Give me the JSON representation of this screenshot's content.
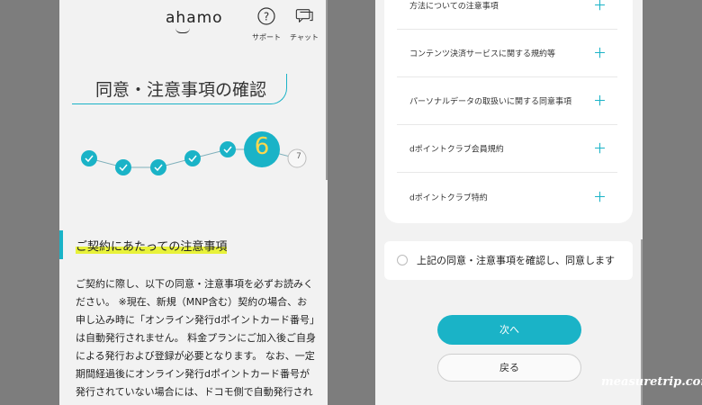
{
  "header": {
    "logo_text": "ahamo",
    "support_label": "サポート",
    "chat_label": "チャット",
    "support_icon": "question-icon",
    "chat_icon": "chat-bubble-icon"
  },
  "page_title": "同意・注意事項の確認",
  "progress": {
    "current_step": "6",
    "next_step": "7",
    "completed_steps": 5,
    "accent_color": "#1ab3c7"
  },
  "section": {
    "title": "ご契約にあたっての注意事項",
    "body": "ご契約に際し、以下の同意・注意事項を必ずお読みください。 ※現在、新規（MNP含む）契約の場合、お申し込み時に「オンライン発行dポイントカード番号」は自動発行されません。 料金プランにご加入後ご自身による発行および登録が必要となります。 なお、一定期間経過後にオンライン発行dポイントカード番号が発行されていない場合には、ドコモ側で自動発行されますので、..."
  },
  "terms": [
    {
      "label": "方法についての注意事項",
      "icon": "plus-icon"
    },
    {
      "label": "コンテンツ決済サービスに関する規約等",
      "icon": "plus-icon"
    },
    {
      "label": "パーソナルデータの取扱いに関する同意事項",
      "icon": "plus-icon"
    },
    {
      "label": "dポイントクラブ会員規約",
      "icon": "plus-icon"
    },
    {
      "label": "dポイントクラブ特約",
      "icon": "plus-icon"
    }
  ],
  "agree": {
    "label": "上記の同意・注意事項を確認し、同意します",
    "checked": false
  },
  "buttons": {
    "next_label": "次へ",
    "back_label": "戻る"
  },
  "watermark": "measuretrip.com"
}
